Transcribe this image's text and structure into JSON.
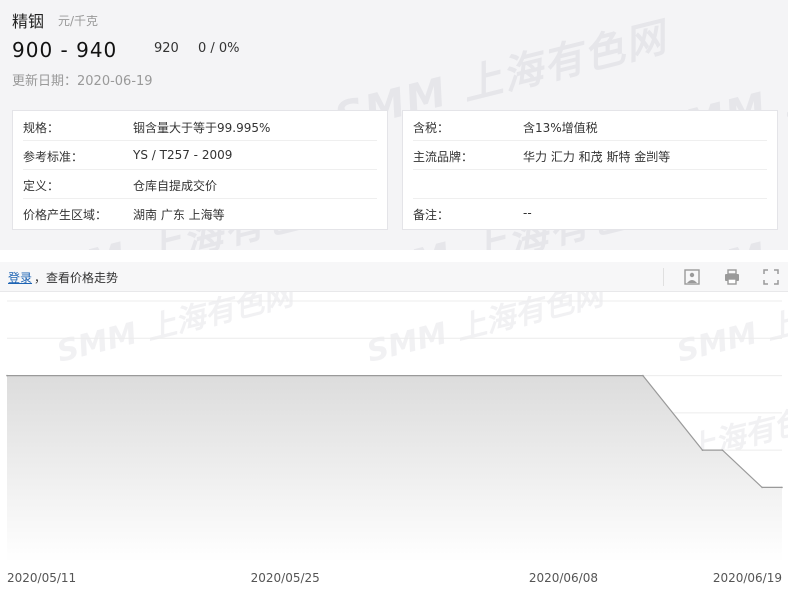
{
  "product": {
    "name": "精铟",
    "unit": "元/千克",
    "price_range": "900 - 940",
    "average": "920",
    "change": "0 / 0%",
    "updated": "更新日期：2020-06-19"
  },
  "watermark": {
    "logo": "SMM",
    "site": "上海有色网"
  },
  "specs_left": [
    {
      "label": "规格：",
      "value": "铟含量大于等于99.995%"
    },
    {
      "label": "参考标准：",
      "value": "YS / T257 - 2009"
    },
    {
      "label": "定义：",
      "value": "仓库自提成交价"
    },
    {
      "label": "价格产生区域：",
      "value": "湖南 广东 上海等"
    }
  ],
  "specs_right": [
    {
      "label": "含税：",
      "value": "含13%增值税"
    },
    {
      "label": "主流品牌：",
      "value": "华力 汇力 和茂 斯特 金剀等"
    },
    {
      "label": "",
      "value": ""
    },
    {
      "label": "备注：",
      "value": "--"
    }
  ],
  "trend_bar": {
    "login_label": "登录",
    "hint": "，查看价格走势",
    "icons": [
      "picture-icon",
      "print-icon",
      "fullscreen-icon"
    ]
  },
  "chart_data": {
    "type": "area",
    "x": [
      "2020/05/11",
      "2020/05/25",
      "2020/06/08",
      "2020/06/19"
    ],
    "tick_labels": [
      "2020/05/11",
      "2020/05/25",
      "2020/06/08",
      "2020/06/19"
    ],
    "series": [
      {
        "points": [
          {
            "x": "2020/05/11",
            "y": 920
          },
          {
            "x": "2020/06/12",
            "y": 920
          },
          {
            "x": "2020/06/15",
            "y": 900
          },
          {
            "x": "2020/06/16",
            "y": 900
          },
          {
            "x": "2020/06/18",
            "y": 890
          },
          {
            "x": "2020/06/19",
            "y": 890
          }
        ]
      }
    ],
    "xlim": [
      "2020/05/11",
      "2020/06/19"
    ],
    "ylim": [
      870,
      940
    ],
    "grid": true,
    "colors": {
      "line": "#9a9a9a",
      "fill_top": "#dcdcdc",
      "fill_bottom": "#ffffff",
      "grid": "#ececec"
    }
  }
}
